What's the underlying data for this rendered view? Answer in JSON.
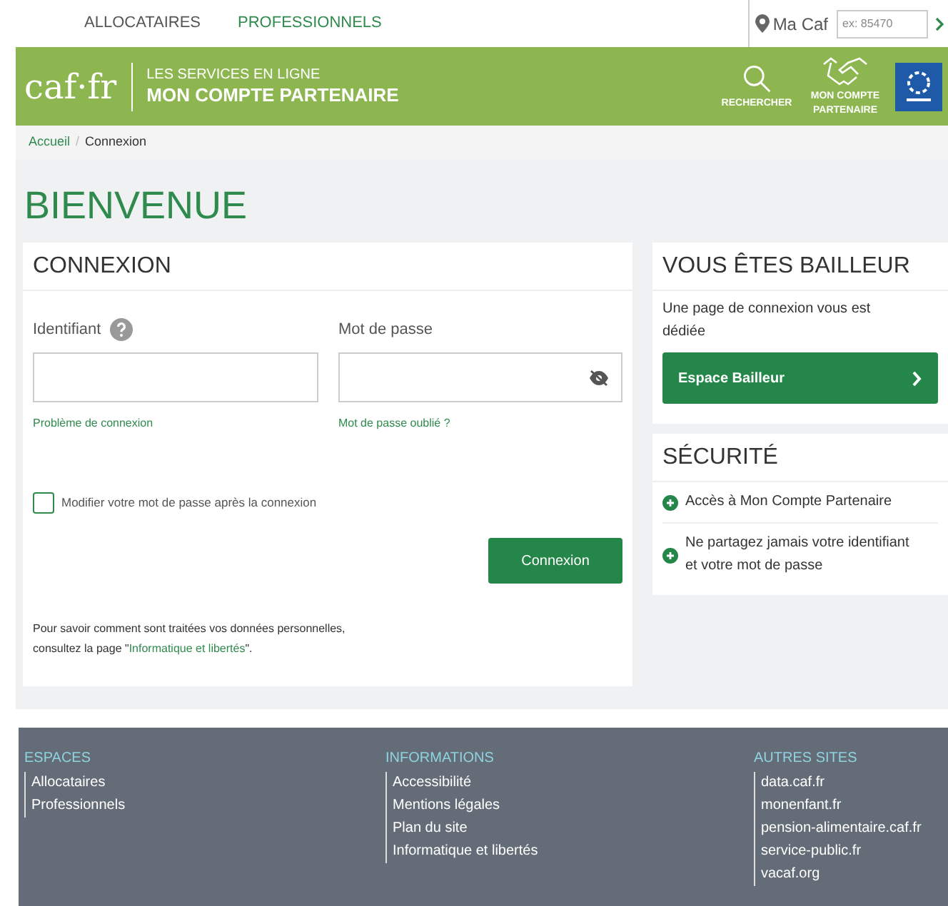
{
  "top_nav": {
    "tabs": [
      {
        "label": "ALLOCATAIRES",
        "selected": false
      },
      {
        "label": "PROFESSIONNELS",
        "selected": true
      }
    ],
    "ma_caf": "Ma Caf",
    "postcode_placeholder": "ex: 85470"
  },
  "header": {
    "logo": "caf·fr",
    "subtitle": "LES SERVICES EN LIGNE",
    "title": "MON COMPTE PARTENAIRE",
    "actions": [
      {
        "kind": "search",
        "label": "RECHERCHER"
      },
      {
        "kind": "handshake",
        "label": "MON COMPTE PARTENAIRE"
      }
    ]
  },
  "breadcrumb": [
    "Accueil",
    "/",
    "Connexion"
  ],
  "page_title": "BIENVENUE",
  "login": {
    "title": "CONNEXION",
    "identifier_label": "Identifiant",
    "password_label": "Mot de passe",
    "problem_link": "Problème de connexion",
    "forgot_link": "Mot de passe oublié ?",
    "change_password": {
      "label": "Modifier votre mot de passe après la connexion",
      "checked": false
    },
    "submit": "Connexion",
    "privacy_text": "Pour savoir comment sont traitées vos données personnelles,",
    "privacy_prefix": "consultez la page \"",
    "privacy_link": "Informatique et libertés",
    "privacy_suffix": "\"."
  },
  "landlord": {
    "title": "VOUS ÊTES BAILLEUR",
    "text": "Une page de connexion vous est dédiée",
    "button": "Espace Bailleur"
  },
  "security": {
    "title": "SÉCURITÉ",
    "items": [
      "Accès à Mon Compte Partenaire",
      "Ne partagez jamais votre identifiant et votre mot de passe"
    ]
  },
  "footer": {
    "columns": [
      {
        "title": "ESPACES",
        "links": [
          "Allocataires",
          "Professionnels"
        ]
      },
      {
        "title": "INFORMATIONS",
        "links": [
          "Accessibilité",
          "Mentions légales",
          "Plan du site",
          "Informatique et libertés"
        ]
      },
      {
        "title": "AUTRES SITES",
        "links": [
          "data.caf.fr",
          "monenfant.fr",
          "pension-alimentaire.caf.fr",
          "service-public.fr",
          "vacaf.org"
        ]
      }
    ]
  }
}
